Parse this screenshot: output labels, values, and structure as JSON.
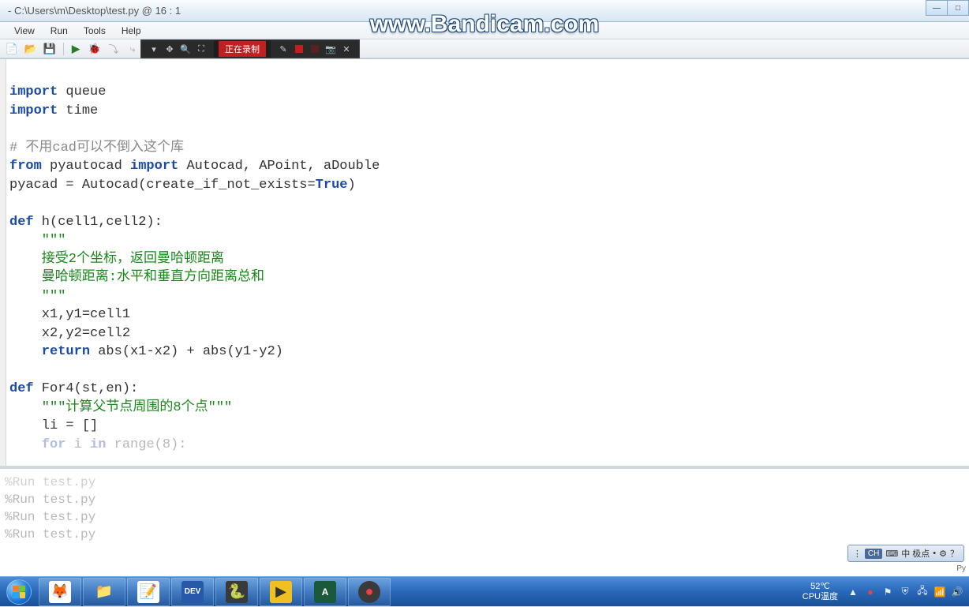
{
  "window": {
    "title": "- C:\\Users\\m\\Desktop\\test.py @ 16 : 1"
  },
  "watermark": "www.Bandicam.com",
  "menu": {
    "items": [
      "View",
      "Run",
      "Tools",
      "Help"
    ]
  },
  "bandicam": {
    "recording_label": "正在录制"
  },
  "code": {
    "lines": [
      {
        "t": "kw",
        "s": "import"
      },
      {
        "t": "line1_rest",
        "s": " queue"
      },
      {
        "t": "line2_kw",
        "s": "import"
      },
      {
        "t": "line2_rest",
        "s": " time"
      },
      {
        "t": "blank"
      },
      {
        "t": "comment",
        "s": "# 不用cad可以不倒入这个库"
      },
      {
        "t": "from_kw",
        "s": "from"
      },
      {
        "t": "from_mid",
        "s": " pyautocad "
      },
      {
        "t": "import_kw",
        "s": "import"
      },
      {
        "t": "from_rest",
        "s": " Autocad, APoint, aDouble"
      },
      {
        "t": "pyacad",
        "s": "pyacad = Autocad(create_if_not_exists="
      },
      {
        "t": "true",
        "s": "True"
      },
      {
        "t": "pyacad_end",
        "s": ")"
      },
      {
        "t": "blank"
      },
      {
        "t": "def_kw",
        "s": "def"
      },
      {
        "t": "def_h",
        "s": " h(cell1,cell2):"
      },
      {
        "t": "doc1",
        "s": "    \"\"\""
      },
      {
        "t": "doc2",
        "s": "    接受2个坐标，返回曼哈顿距离"
      },
      {
        "t": "doc3",
        "s": "    曼哈顿距离:水平和垂直方向距离总和"
      },
      {
        "t": "doc4",
        "s": "    \"\"\""
      },
      {
        "t": "body1",
        "s": "    x1,y1=cell1"
      },
      {
        "t": "body2",
        "s": "    x2,y2=cell2"
      },
      {
        "t": "ret_kw",
        "s": "    return"
      },
      {
        "t": "ret_rest",
        "s": " abs(x1-x2) + abs(y1-y2)"
      },
      {
        "t": "blank"
      },
      {
        "t": "def2_kw",
        "s": "def"
      },
      {
        "t": "def2_rest",
        "s": " For4(st,en):"
      },
      {
        "t": "doc5",
        "s": "    \"\"\"计算父节点周围的8个点\"\"\""
      },
      {
        "t": "body3",
        "s": "    li = []"
      },
      {
        "t": "for_kw",
        "s": "    for"
      },
      {
        "t": "for_mid",
        "s": " i "
      },
      {
        "t": "in_kw",
        "s": "in"
      },
      {
        "t": "for_rest",
        "s": " range(8):"
      }
    ]
  },
  "console": {
    "lines": [
      "%Run test.py",
      "%Run test.py",
      "%Run test.py",
      "%Run test.py"
    ]
  },
  "ime": {
    "lang": "CH",
    "label": "中 极点"
  },
  "statusbar_right": "Py",
  "tray": {
    "temp": "52℃",
    "cpu_label": "CPU温度"
  }
}
